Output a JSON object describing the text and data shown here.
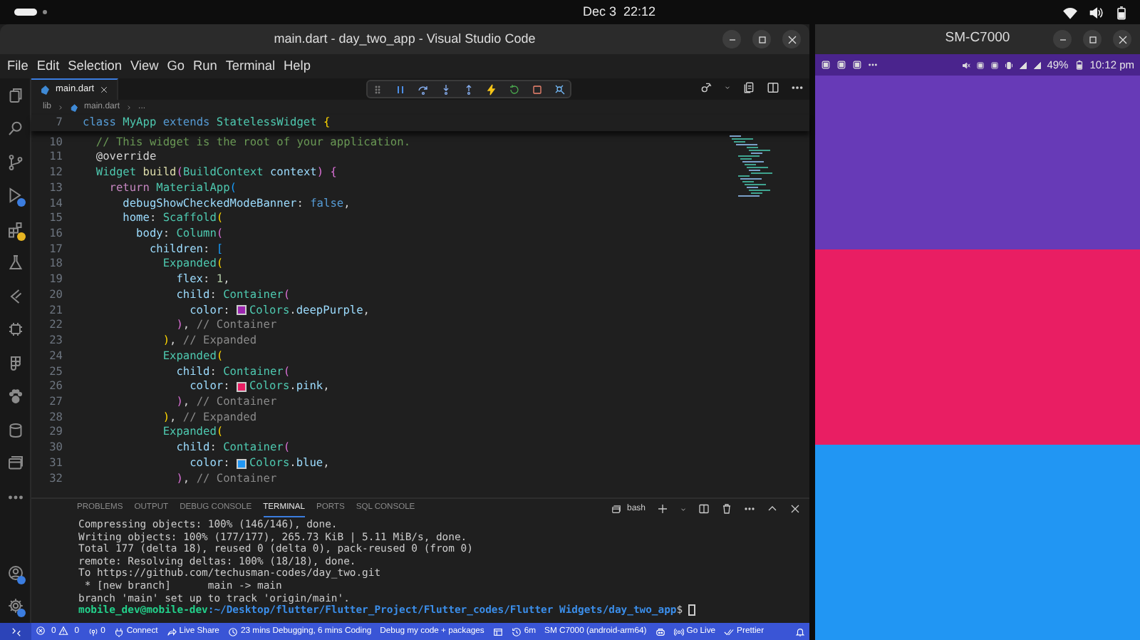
{
  "top_bar": {
    "clock": "Dec 3  22:12"
  },
  "vscode": {
    "title": "main.dart - day_two_app - Visual Studio Code",
    "menu": [
      "File",
      "Edit",
      "Selection",
      "View",
      "Go",
      "Run",
      "Terminal",
      "Help"
    ],
    "activity": [
      {
        "kind": "files",
        "badge": false
      },
      {
        "kind": "search",
        "badge": false
      },
      {
        "kind": "scm",
        "badge": false
      },
      {
        "kind": "debug",
        "badge": true
      },
      {
        "kind": "extensions",
        "badge": true
      },
      {
        "kind": "flask",
        "badge": false
      },
      {
        "kind": "chevrons",
        "badge": false
      },
      {
        "kind": "chip",
        "badge": false
      },
      {
        "kind": "shapes",
        "badge": false
      },
      {
        "kind": "paw",
        "badge": false
      },
      {
        "kind": "database",
        "badge": false
      },
      {
        "kind": "windows",
        "badge": false
      },
      {
        "kind": "more",
        "badge": false
      }
    ],
    "activity_bottom": [
      {
        "kind": "account",
        "badge": true
      },
      {
        "kind": "gear",
        "badge": true
      }
    ],
    "tabs": [
      {
        "label": "main.dart",
        "selected": true
      }
    ],
    "breadcrumb": [
      "lib",
      "main.dart",
      "..."
    ],
    "sticky": {
      "num": "7",
      "segments": [
        {
          "kind": "kw",
          "text": "class "
        },
        {
          "kind": "type",
          "text": "MyApp "
        },
        {
          "kind": "kw",
          "text": "extends "
        },
        {
          "kind": "type",
          "text": "StatelessWidget "
        },
        {
          "kind": "b1",
          "text": "{"
        }
      ]
    },
    "lines": [
      {
        "num": "10",
        "segments": [
          {
            "kind": "cm",
            "text": "  // This widget is the root of your application."
          }
        ]
      },
      {
        "num": "11",
        "segments": [
          {
            "kind": "p",
            "text": "  @override"
          }
        ]
      },
      {
        "num": "12",
        "segments": [
          {
            "kind": "type",
            "text": "  Widget "
          },
          {
            "kind": "fn",
            "text": "build"
          },
          {
            "kind": "b2",
            "text": "("
          },
          {
            "kind": "type",
            "text": "BuildContext "
          },
          {
            "kind": "var",
            "text": "context"
          },
          {
            "kind": "b2",
            "text": ") {"
          }
        ]
      },
      {
        "num": "13",
        "segments": [
          {
            "kind": "ctl",
            "text": "    return "
          },
          {
            "kind": "type",
            "text": "MaterialApp"
          },
          {
            "kind": "b3",
            "text": "("
          }
        ]
      },
      {
        "num": "14",
        "segments": [
          {
            "kind": "var",
            "text": "      debugShowCheckedModeBanner"
          },
          {
            "kind": "p",
            "text": ": "
          },
          {
            "kind": "kw",
            "text": "false"
          },
          {
            "kind": "p",
            "text": ","
          }
        ]
      },
      {
        "num": "15",
        "segments": [
          {
            "kind": "var",
            "text": "      home"
          },
          {
            "kind": "p",
            "text": ": "
          },
          {
            "kind": "type",
            "text": "Scaffold"
          },
          {
            "kind": "b1",
            "text": "("
          }
        ]
      },
      {
        "num": "16",
        "segments": [
          {
            "kind": "var",
            "text": "        body"
          },
          {
            "kind": "p",
            "text": ": "
          },
          {
            "kind": "type",
            "text": "Column"
          },
          {
            "kind": "b2",
            "text": "("
          }
        ]
      },
      {
        "num": "17",
        "segments": [
          {
            "kind": "var",
            "text": "          children"
          },
          {
            "kind": "p",
            "text": ": "
          },
          {
            "kind": "b3",
            "text": "["
          }
        ]
      },
      {
        "num": "18",
        "segments": [
          {
            "kind": "type",
            "text": "            Expanded"
          },
          {
            "kind": "b1",
            "text": "("
          }
        ]
      },
      {
        "num": "19",
        "segments": [
          {
            "kind": "var",
            "text": "              flex"
          },
          {
            "kind": "p",
            "text": ": "
          },
          {
            "kind": "num",
            "text": "1"
          },
          {
            "kind": "p",
            "text": ","
          }
        ]
      },
      {
        "num": "20",
        "segments": [
          {
            "kind": "var",
            "text": "              child"
          },
          {
            "kind": "p",
            "text": ": "
          },
          {
            "kind": "type",
            "text": "Container"
          },
          {
            "kind": "b2",
            "text": "("
          }
        ]
      },
      {
        "num": "21",
        "segments": [
          {
            "kind": "var",
            "text": "                color"
          },
          {
            "kind": "p",
            "text": ": "
          },
          {
            "kind": "swatch",
            "color": "#9c27b0"
          },
          {
            "kind": "type",
            "text": "Colors"
          },
          {
            "kind": "p",
            "text": "."
          },
          {
            "kind": "var",
            "text": "deepPurple"
          },
          {
            "kind": "p",
            "text": ","
          }
        ]
      },
      {
        "num": "22",
        "segments": [
          {
            "kind": "b2",
            "text": "              )"
          },
          {
            "kind": "p",
            "text": ", "
          },
          {
            "kind": "gray",
            "text": "// Container"
          }
        ]
      },
      {
        "num": "23",
        "segments": [
          {
            "kind": "b1",
            "text": "            )"
          },
          {
            "kind": "p",
            "text": ", "
          },
          {
            "kind": "gray",
            "text": "// Expanded"
          }
        ]
      },
      {
        "num": "24",
        "segments": [
          {
            "kind": "type",
            "text": "            Expanded"
          },
          {
            "kind": "b1",
            "text": "("
          }
        ]
      },
      {
        "num": "25",
        "segments": [
          {
            "kind": "var",
            "text": "              child"
          },
          {
            "kind": "p",
            "text": ": "
          },
          {
            "kind": "type",
            "text": "Container"
          },
          {
            "kind": "b2",
            "text": "("
          }
        ]
      },
      {
        "num": "26",
        "segments": [
          {
            "kind": "var",
            "text": "                color"
          },
          {
            "kind": "p",
            "text": ": "
          },
          {
            "kind": "swatch",
            "color": "#e91e63"
          },
          {
            "kind": "type",
            "text": "Colors"
          },
          {
            "kind": "p",
            "text": "."
          },
          {
            "kind": "var",
            "text": "pink"
          },
          {
            "kind": "p",
            "text": ","
          }
        ]
      },
      {
        "num": "27",
        "segments": [
          {
            "kind": "b2",
            "text": "              )"
          },
          {
            "kind": "p",
            "text": ", "
          },
          {
            "kind": "gray",
            "text": "// Container"
          }
        ]
      },
      {
        "num": "28",
        "segments": [
          {
            "kind": "b1",
            "text": "            )"
          },
          {
            "kind": "p",
            "text": ", "
          },
          {
            "kind": "gray",
            "text": "// Expanded"
          }
        ]
      },
      {
        "num": "29",
        "segments": [
          {
            "kind": "type",
            "text": "            Expanded"
          },
          {
            "kind": "b1",
            "text": "("
          }
        ]
      },
      {
        "num": "30",
        "segments": [
          {
            "kind": "var",
            "text": "              child"
          },
          {
            "kind": "p",
            "text": ": "
          },
          {
            "kind": "type",
            "text": "Container"
          },
          {
            "kind": "b2",
            "text": "("
          }
        ]
      },
      {
        "num": "31",
        "segments": [
          {
            "kind": "var",
            "text": "                color"
          },
          {
            "kind": "p",
            "text": ": "
          },
          {
            "kind": "swatch",
            "color": "#2196f3"
          },
          {
            "kind": "type",
            "text": "Colors"
          },
          {
            "kind": "p",
            "text": "."
          },
          {
            "kind": "var",
            "text": "blue"
          },
          {
            "kind": "p",
            "text": ","
          }
        ]
      },
      {
        "num": "32",
        "segments": [
          {
            "kind": "b2",
            "text": "              )"
          },
          {
            "kind": "p",
            "text": ", "
          },
          {
            "kind": "gray",
            "text": "// Container"
          }
        ]
      }
    ],
    "panel_tabs": [
      {
        "label": "PROBLEMS",
        "selected": false
      },
      {
        "label": "OUTPUT",
        "selected": false
      },
      {
        "label": "DEBUG CONSOLE",
        "selected": false
      },
      {
        "label": "TERMINAL",
        "selected": true
      },
      {
        "label": "PORTS",
        "selected": false
      },
      {
        "label": "SQL CONSOLE",
        "selected": false
      }
    ],
    "shell": "bash",
    "terminal": [
      "Compressing objects: 100% (146/146), done.",
      "Writing objects: 100% (177/177), 265.73 KiB | 5.11 MiB/s, done.",
      "Total 177 (delta 18), reused 0 (delta 0), pack-reused 0 (from 0)",
      "remote: Resolving deltas: 100% (18/18), done.",
      "To https://github.com/techusman-codes/day_two.git",
      " * [new branch]      main -> main",
      "branch 'main' set up to track 'origin/main'."
    ],
    "prompt": {
      "user": "mobile_dev@mobile-dev",
      "path": ":~/Desktop/flutter/Flutter_Project/Flutter_codes/Flutter Widgets/day_two_app",
      "symbol": "$"
    },
    "status": [
      {
        "kind": "remote"
      },
      {
        "kind": "problems",
        "errors": "0",
        "warnings": "0"
      },
      {
        "kind": "ports",
        "text": "0"
      },
      {
        "kind": "connect",
        "text": "Connect"
      },
      {
        "kind": "share",
        "text": "Live Share"
      },
      {
        "kind": "timer",
        "text": "23 mins Debugging, 6 mins Coding"
      },
      {
        "kind": "plain",
        "text": "Debug my code + packages"
      },
      {
        "kind": "layout"
      },
      {
        "kind": "clock",
        "text": "6m"
      },
      {
        "kind": "plain",
        "text": "SM C7000 (android-arm64)"
      },
      {
        "kind": "robot"
      },
      {
        "kind": "live",
        "text": "Go Live"
      },
      {
        "kind": "check",
        "text": "Prettier"
      },
      {
        "kind": "bell"
      }
    ]
  },
  "phone": {
    "title": "SM-C7000",
    "battery": "49%",
    "time": "10:12 pm",
    "panels": [
      {
        "color": "#673ab7"
      },
      {
        "color": "#e91e63"
      },
      {
        "color": "#2196f3"
      }
    ]
  }
}
